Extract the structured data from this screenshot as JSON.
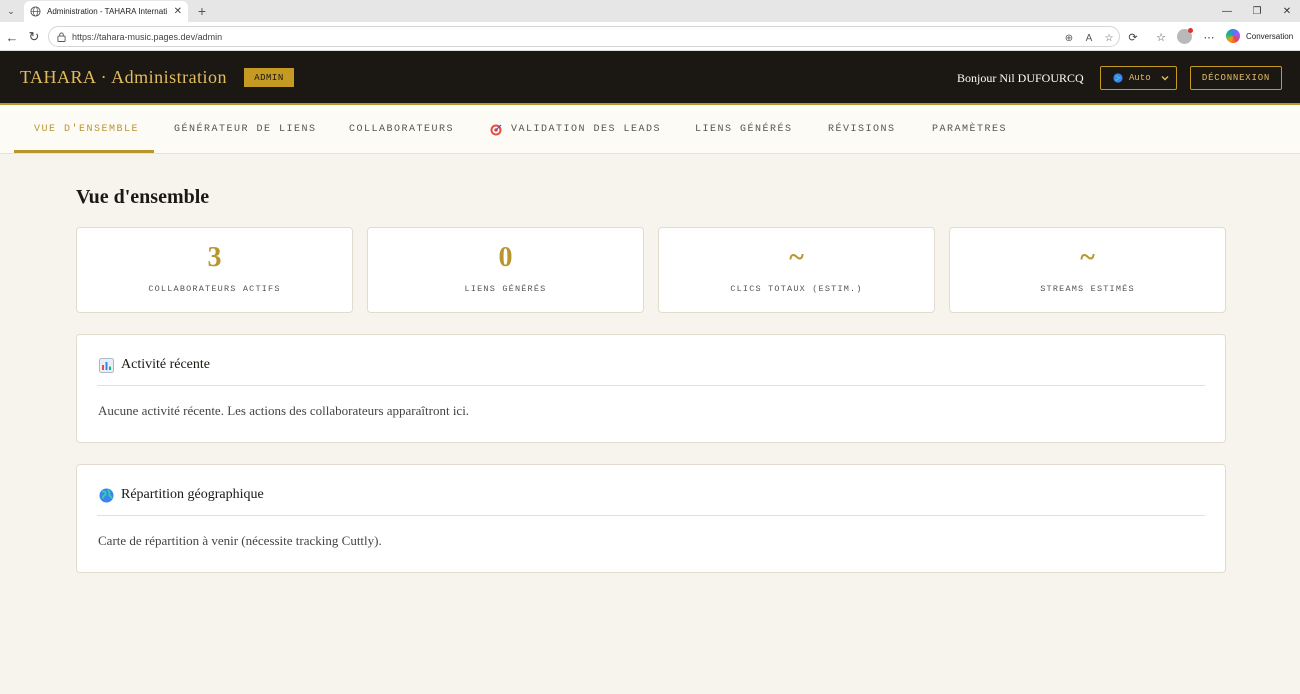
{
  "browser": {
    "tab_title": "Administration - TAHARA Internati",
    "url": "https://tahara-music.pages.dev/admin",
    "copilot_label": "Conversation"
  },
  "header": {
    "brand": "TAHARA · Administration",
    "badge": "ADMIN",
    "greeting": "Bonjour Nil DUFOURCQ",
    "language": "Auto",
    "logout": "DÉCONNEXION"
  },
  "nav": {
    "tabs": [
      {
        "label": "VUE D'ENSEMBLE"
      },
      {
        "label": "GÉNÉRATEUR DE LIENS"
      },
      {
        "label": "COLLABORATEURS"
      },
      {
        "label": "VALIDATION DES LEADS"
      },
      {
        "label": "LIENS GÉNÉRÉS"
      },
      {
        "label": "RÉVISIONS"
      },
      {
        "label": "PARAMÈTRES"
      }
    ]
  },
  "main": {
    "title": "Vue d'ensemble",
    "stats": [
      {
        "value": "3",
        "label": "COLLABORATEURS ACTIFS"
      },
      {
        "value": "0",
        "label": "LIENS GÉNÉRÉS"
      },
      {
        "value": "~",
        "label": "CLICS TOTAUX (ESTIM.)"
      },
      {
        "value": "~",
        "label": "STREAMS ESTIMÉS"
      }
    ],
    "activity": {
      "title": "Activité récente",
      "text": "Aucune activité récente. Les actions des collaborateurs apparaîtront ici."
    },
    "geo": {
      "title": "Répartition géographique",
      "text": "Carte de répartition à venir (nécessite tracking Cuttly)."
    }
  },
  "colors": {
    "accent": "#b8962e",
    "header_bg": "#1b1813",
    "page_bg": "#f7f4ee"
  }
}
